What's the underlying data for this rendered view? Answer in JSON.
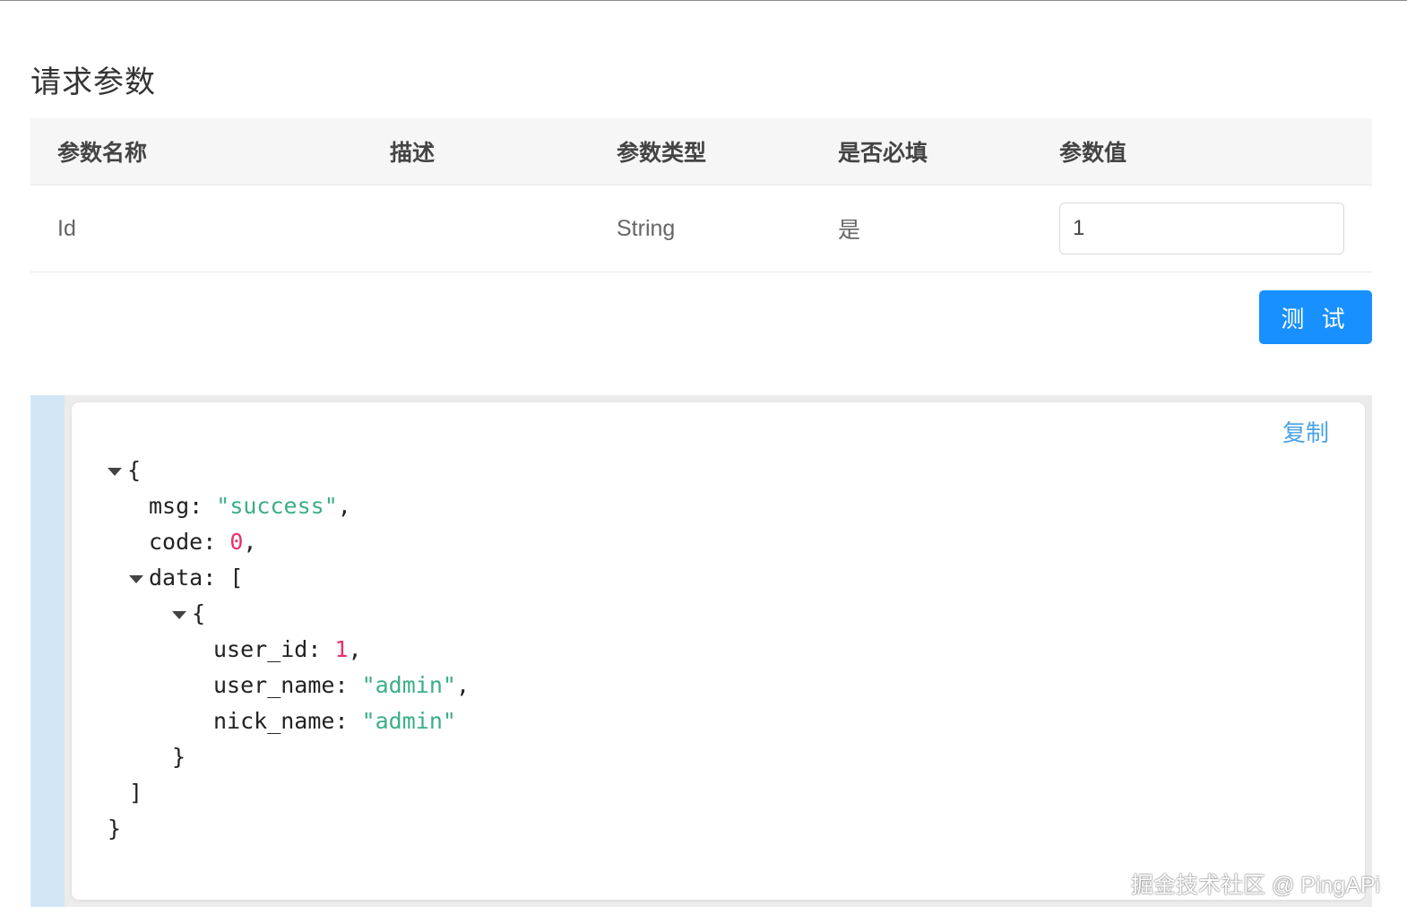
{
  "section": {
    "title": "请求参数"
  },
  "table": {
    "headers": [
      "参数名称",
      "描述",
      "参数类型",
      "是否必填",
      "参数值"
    ],
    "rows": [
      {
        "name": "Id",
        "description": "",
        "type": "String",
        "required": "是",
        "value": "1"
      }
    ]
  },
  "actions": {
    "test_label": "测 试"
  },
  "response": {
    "copy_label": "复制",
    "json": {
      "open_brace": "{",
      "msg_key": "msg:",
      "msg_value": "\"success\"",
      "code_key": "code:",
      "code_value": "0",
      "data_key": "data:",
      "data_open": "[",
      "item_open": "{",
      "user_id_key": "user_id:",
      "user_id_value": "1",
      "user_name_key": "user_name:",
      "user_name_value": "\"admin\"",
      "nick_name_key": "nick_name:",
      "nick_name_value": "\"admin\"",
      "item_close": "}",
      "data_close": "]",
      "close_brace": "}"
    }
  },
  "watermark": "掘金技术社区 @ PingAPi",
  "colors": {
    "primary": "#1890ff",
    "string": "#3aaf85",
    "number": "#e8306a",
    "accent_bar": "#d3e6f6",
    "link": "#4aa3e6"
  }
}
